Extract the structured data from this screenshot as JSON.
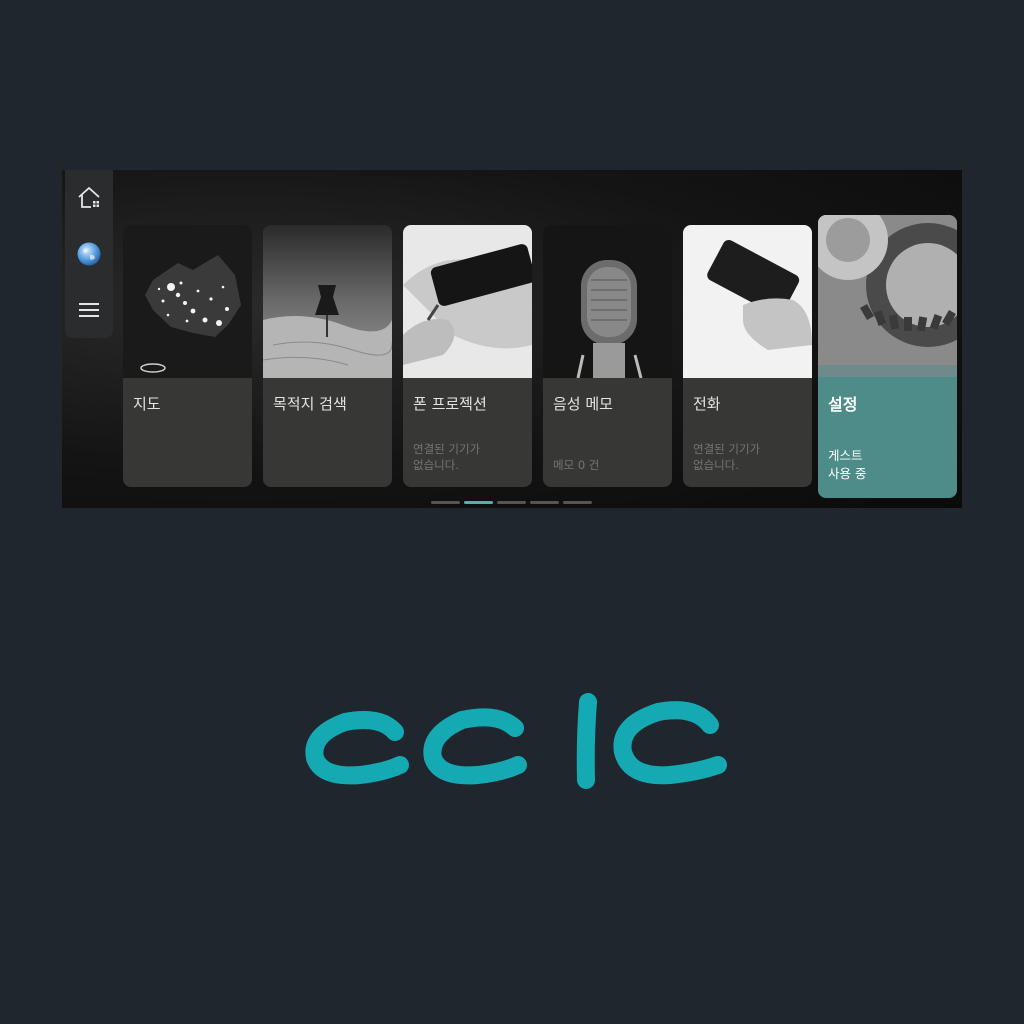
{
  "sidebar": {
    "items": [
      {
        "icon": "home-icon"
      },
      {
        "icon": "globe-icon"
      },
      {
        "icon": "menu-icon"
      }
    ]
  },
  "cards": [
    {
      "title": "지도",
      "subtitle": "",
      "image": "korea-night-map"
    },
    {
      "title": "목적지 검색",
      "subtitle": "",
      "image": "pushpin-on-map"
    },
    {
      "title": "폰 프로젝션",
      "subtitle_line1": "연결된 기기가",
      "subtitle_line2": "없습니다.",
      "image": "hand-holding-phone"
    },
    {
      "title": "음성 메모",
      "subtitle": "메모 0 건",
      "image": "studio-microphone"
    },
    {
      "title": "전화",
      "subtitle_line1": "연결된 기기가",
      "subtitle_line2": "없습니다.",
      "image": "hand-holding-phone"
    },
    {
      "title": "설정",
      "subtitle_line1": "게스트",
      "subtitle_line2": "사용 중",
      "image": "gears"
    }
  ],
  "pager": {
    "count": 5,
    "active_index": 1
  },
  "logo": {
    "text": "cclc",
    "color": "#15aab3"
  },
  "colors": {
    "background": "#1f262e",
    "accent": "#4fb3ad",
    "active_card": "#4e8c8a"
  }
}
